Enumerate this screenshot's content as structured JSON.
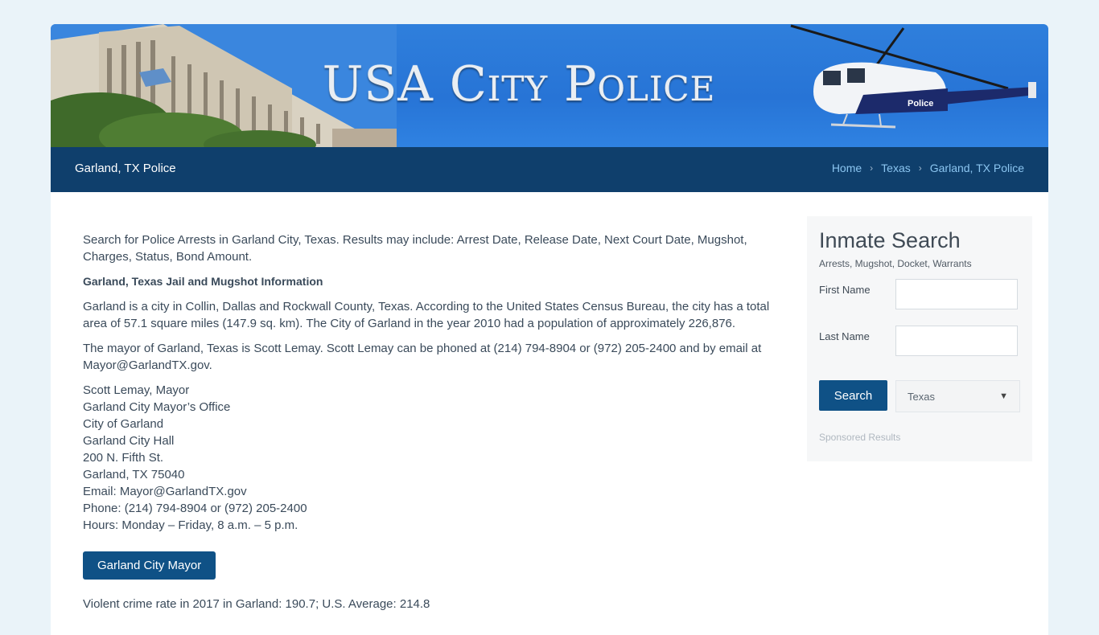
{
  "banner": {
    "title": "USA City Police"
  },
  "titlebar": {
    "page_title": "Garland, TX Police",
    "breadcrumbs": [
      "Home",
      "Texas",
      "Garland, TX Police"
    ]
  },
  "main": {
    "intro": "Search for Police Arrests in Garland City, Texas. Results may include: Arrest Date, Release Date, Next Court Date, Mugshot, Charges, Status, Bond Amount.",
    "heading": "Garland, Texas Jail and Mugshot Information",
    "para1": "Garland is a city in Collin, Dallas and Rockwall County, Texas. According to the United States Census Bureau, the city has a total area of 57.1 square miles (147.9 sq. km). The City of Garland in the year 2010 had a population of approximately 226,876.",
    "para2": "The mayor of Garland, Texas is Scott Lemay. Scott Lemay can be phoned at (214) 794-8904 or (972) 205-2400 and by email at Mayor@GarlandTX.gov.",
    "address": [
      "Scott Lemay, Mayor",
      "Garland City Mayor’s Office",
      "City of Garland",
      "Garland City Hall",
      "200 N. Fifth St.",
      "Garland, TX 75040",
      "Email: Mayor@GarlandTX.gov",
      "Phone: (214) 794-8904 or (972) 205-2400",
      "Hours: Monday – Friday, 8 a.m. – 5 p.m."
    ],
    "mayor_button": "Garland City Mayor",
    "crime": "Violent crime rate in 2017 in Garland: 190.7; U.S. Average: 214.8"
  },
  "sidebar": {
    "title": "Inmate Search",
    "subtitle": "Arrests, Mugshot, Docket, Warrants",
    "first_name_label": "First Name",
    "last_name_label": "Last Name",
    "search_button": "Search",
    "state_selected": "Texas",
    "sponsored": "Sponsored Results"
  }
}
